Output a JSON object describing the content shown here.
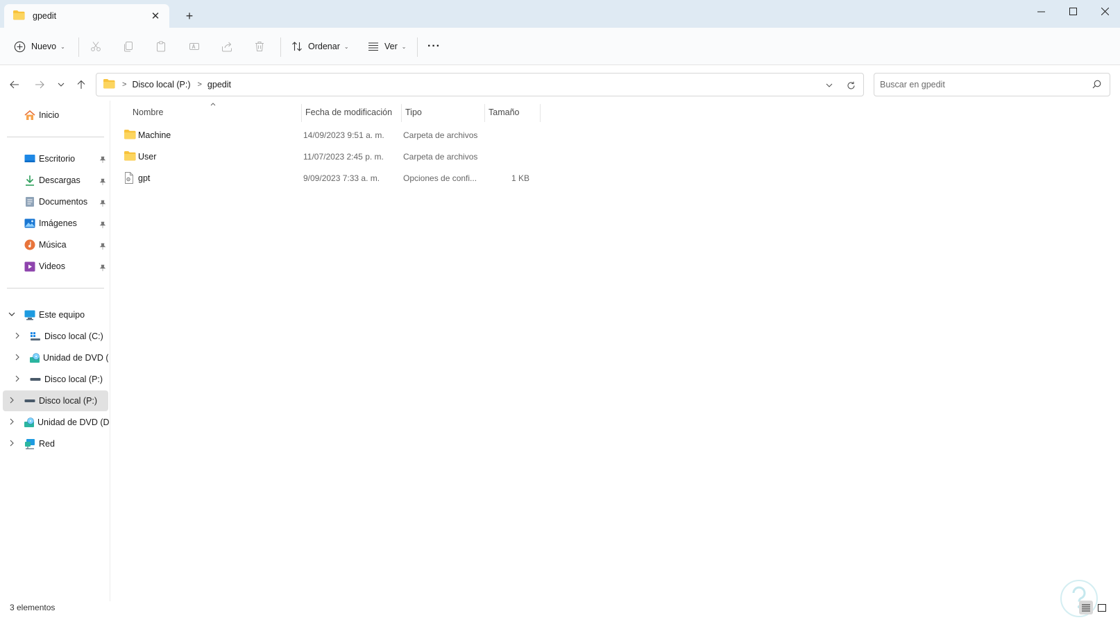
{
  "window": {
    "tab_title": "gpedit",
    "new_tab": "+",
    "close_tab": "✕"
  },
  "toolbar": {
    "new_label": "Nuevo",
    "sort_label": "Ordenar",
    "view_label": "Ver",
    "more_label": "···",
    "icons": [
      "cut-icon",
      "copy-icon",
      "paste-icon",
      "rename-icon",
      "share-icon",
      "delete-icon"
    ]
  },
  "address": {
    "crumbs": [
      "Disco local (P:)",
      "gpedit"
    ],
    "search_placeholder": "Buscar en gpedit"
  },
  "sidebar": {
    "home": "Inicio",
    "quick": [
      {
        "label": "Escritorio",
        "icon": "desktop-icon",
        "color": "#1e88e5"
      },
      {
        "label": "Descargas",
        "icon": "download-icon",
        "color": "#2e9e5b"
      },
      {
        "label": "Documentos",
        "icon": "documents-icon",
        "color": "#7a8fa6"
      },
      {
        "label": "Imágenes",
        "icon": "pictures-icon",
        "color": "#1976d2"
      },
      {
        "label": "Música",
        "icon": "music-icon",
        "color": "#e8743b"
      },
      {
        "label": "Videos",
        "icon": "videos-icon",
        "color": "#8e44ad"
      }
    ],
    "this_pc": "Este equipo",
    "this_pc_children": [
      "Disco local (C:)",
      "Unidad de DVD (D",
      "Disco local (P:)"
    ],
    "drives": [
      "Disco local (P:)",
      "Unidad de DVD (D:)",
      "Red"
    ]
  },
  "list": {
    "columns": {
      "name": "Nombre",
      "date": "Fecha de modificación",
      "type": "Tipo",
      "size": "Tamaño"
    },
    "rows": [
      {
        "name": "Machine",
        "date": "14/09/2023 9:51 a. m.",
        "type": "Carpeta de archivos",
        "size": "",
        "icon": "folder-icon"
      },
      {
        "name": "User",
        "date": "11/07/2023 2:45 p. m.",
        "type": "Carpeta de archivos",
        "size": "",
        "icon": "folder-icon"
      },
      {
        "name": "gpt",
        "date": "9/09/2023 7:33 a. m.",
        "type": "Opciones de confi...",
        "size": "1 KB",
        "icon": "ini-file-icon"
      }
    ]
  },
  "status": {
    "count": "3 elementos"
  },
  "colors": {
    "titlebar": "#dfeaf3",
    "folder": "#f8c33c",
    "selected": "#e1e1e1"
  }
}
